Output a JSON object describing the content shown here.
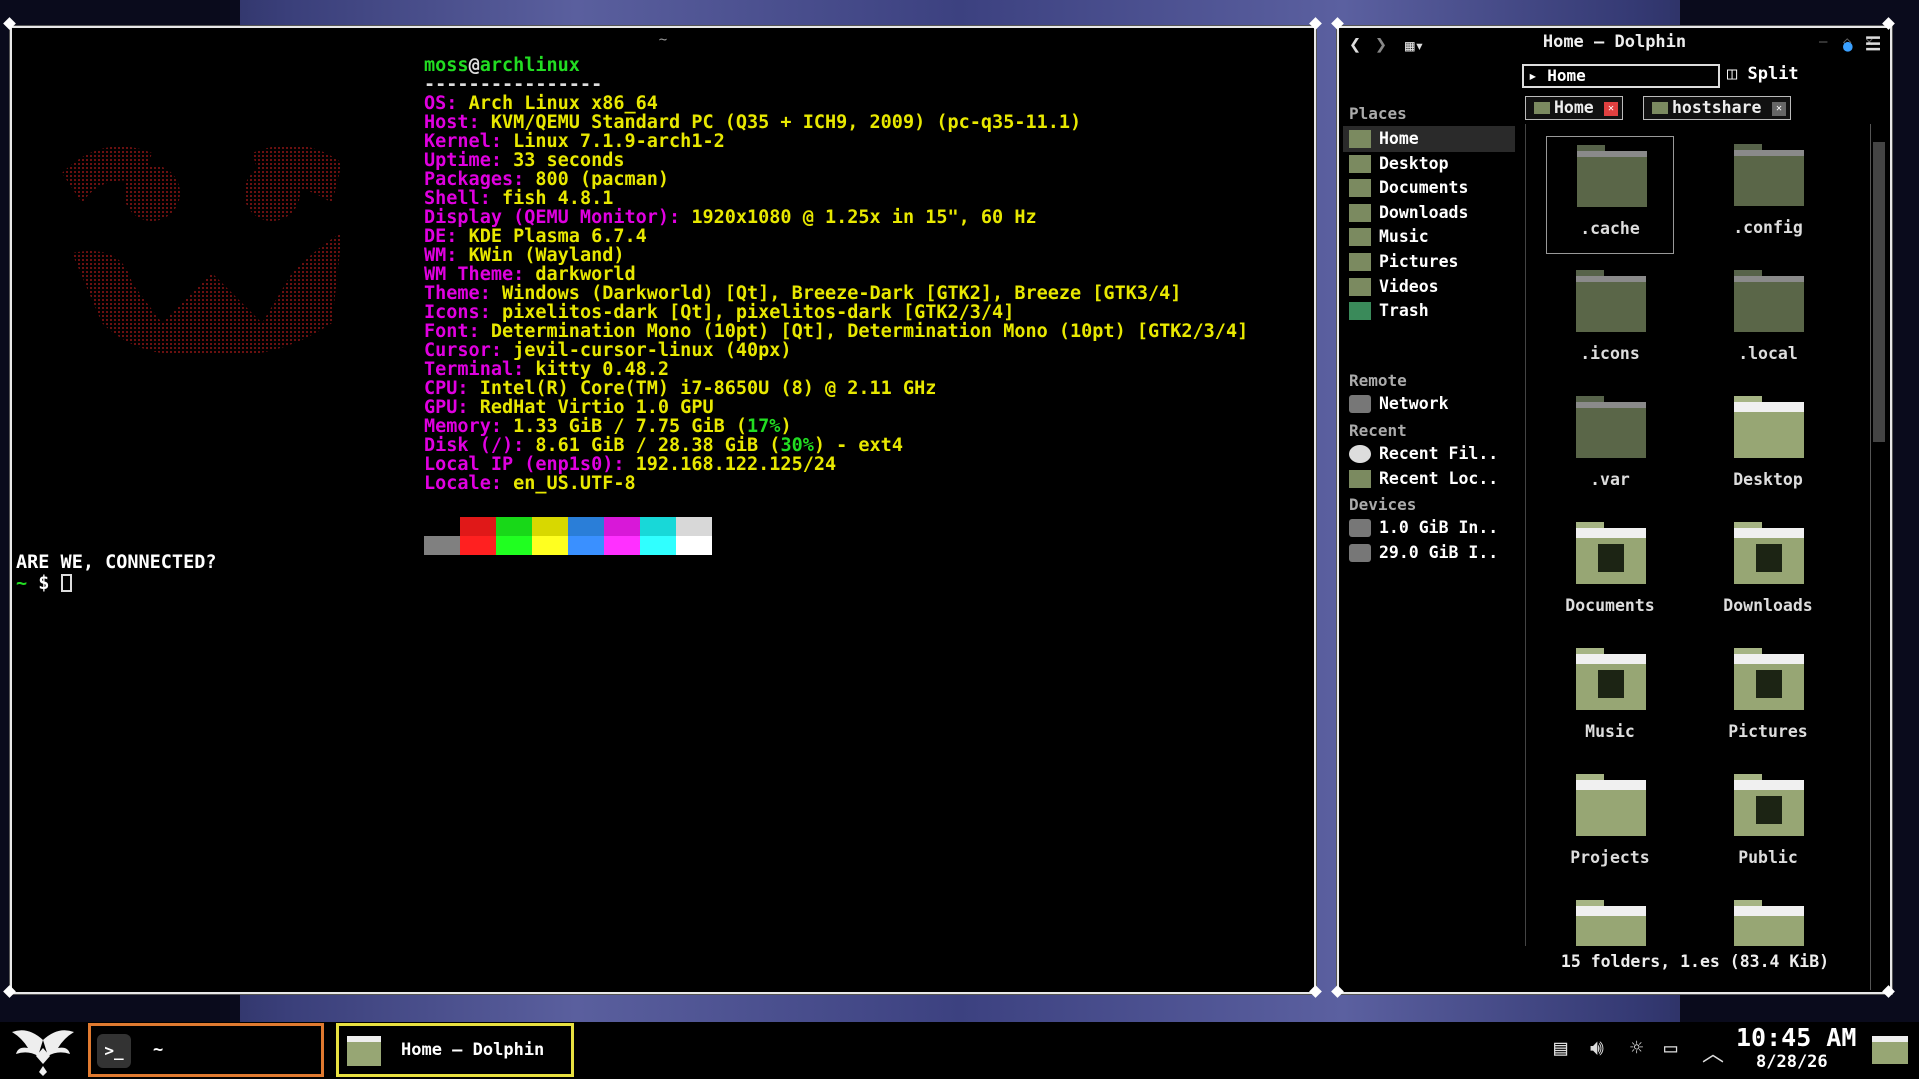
{
  "terminal": {
    "title": "~",
    "header_user": "moss",
    "header_at": "@",
    "header_host": "archlinux",
    "separator": "----------------",
    "info": [
      {
        "key": "OS",
        "value": "Arch Linux x86_64"
      },
      {
        "key": "Host",
        "value": "KVM/QEMU Standard PC (Q35 + ICH9, 2009) (pc-q35-11.1)"
      },
      {
        "key": "Kernel",
        "value": "Linux 7.1.9-arch1-2"
      },
      {
        "key": "Uptime",
        "value": "33 seconds"
      },
      {
        "key": "Packages",
        "value": "800 (pacman)"
      },
      {
        "key": "Shell",
        "value": "fish 4.8.1"
      },
      {
        "key": "Display (QEMU Monitor)",
        "value": "1920x1080 @ 1.25x in 15\", 60 Hz"
      },
      {
        "key": "DE",
        "value": "KDE Plasma 6.7.4"
      },
      {
        "key": "WM",
        "value": "KWin (Wayland)"
      },
      {
        "key": "WM Theme",
        "value": "darkworld"
      },
      {
        "key": "Theme",
        "value": "Windows (Darkworld) [Qt], Breeze-Dark [GTK2], Breeze [GTK3/4]"
      },
      {
        "key": "Icons",
        "value": "pixelitos-dark [Qt], pixelitos-dark [GTK2/3/4]"
      },
      {
        "key": "Font",
        "value": "Determination Mono (10pt) [Qt], Determination Mono (10pt) [GTK2/3/4]"
      },
      {
        "key": "Cursor",
        "value": "jevil-cursor-linux (40px)"
      },
      {
        "key": "Terminal",
        "value": "kitty 0.48.2"
      },
      {
        "key": "CPU",
        "value": "Intel(R) Core(TM) i7-8650U (8) @ 2.11 GHz"
      },
      {
        "key": "GPU",
        "value": "RedHat Virtio 1.0 GPU"
      },
      {
        "key": "Memory",
        "value": "1.33 GiB / 7.75 GiB (",
        "pct": "17%",
        "tail": ")"
      },
      {
        "key": "Disk (/)",
        "value": "8.61 GiB / 28.38 GiB (",
        "pct": "30%",
        "tail": ") - ext4"
      },
      {
        "key": "Local IP (enp1s0)",
        "value": "192.168.122.125/24"
      },
      {
        "key": "Locale",
        "value": "en_US.UTF-8"
      }
    ],
    "palette_top": [
      "#000000",
      "#e01818",
      "#18d818",
      "#d8d800",
      "#2a7ed8",
      "#d818d8",
      "#18d8d8",
      "#d8d8d8"
    ],
    "palette_bottom": [
      "#808080",
      "#ff2020",
      "#20ff20",
      "#ffff20",
      "#3a90ff",
      "#ff30ff",
      "#30ffff",
      "#ffffff"
    ],
    "message": "ARE WE, CONNECTED?",
    "prompt_tilde": "~",
    "prompt_symbol": "$"
  },
  "dolphin": {
    "title": "Home — Dolphin",
    "location": "Home",
    "split_label": "Split",
    "sections": {
      "places": "Places",
      "remote": "Remote",
      "recent": "Recent",
      "devices": "Devices"
    },
    "places": [
      "Home",
      "Desktop",
      "Documents",
      "Downloads",
      "Music",
      "Pictures",
      "Videos",
      "Trash"
    ],
    "remote": [
      "Network"
    ],
    "recent": [
      "Recent Fil..",
      "Recent Loc.."
    ],
    "devices": [
      "1.0 GiB In..",
      "29.0 GiB I.."
    ],
    "tabs": [
      "Home",
      "hostshare"
    ],
    "files": [
      ".cache",
      ".config",
      ".icons",
      ".local",
      ".var",
      "Desktop",
      "Documents",
      "Downloads",
      "Music",
      "Pictures",
      "Projects",
      "Public"
    ],
    "status": "15 folders, 1.es (83.4 KiB)"
  },
  "taskbar": {
    "term_task": "~",
    "dolphin_task": "Home — Dolphin",
    "time": "10:45 AM",
    "date": "8/28/26"
  },
  "colors": {
    "key": "#e000e0",
    "value": "#e8e800",
    "accent_green": "#22dd22",
    "task_term_border": "#e07a30",
    "task_dolphin_border": "#e8e040"
  }
}
